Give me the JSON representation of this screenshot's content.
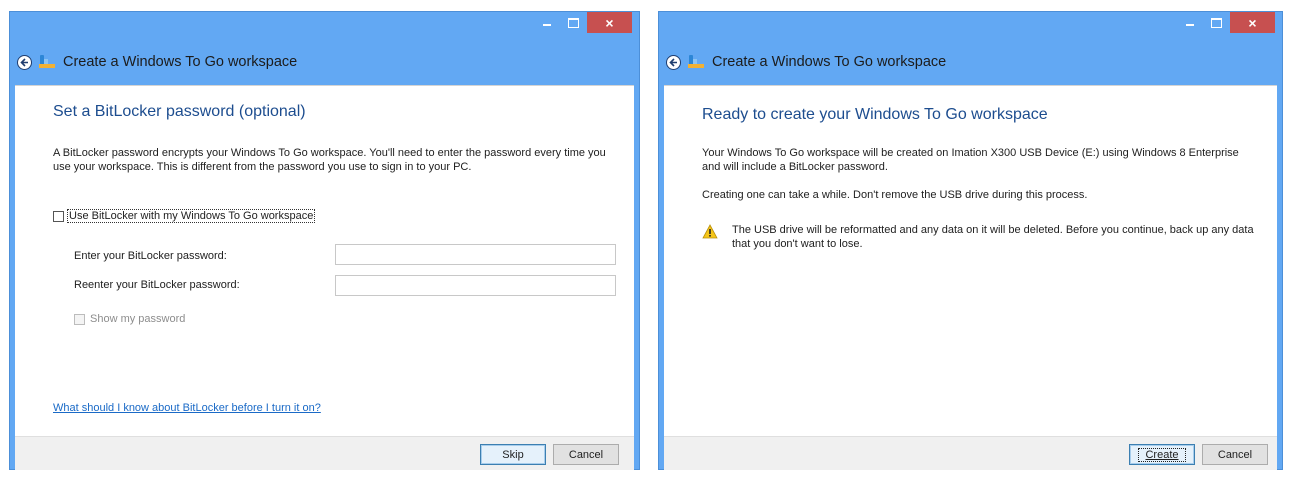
{
  "left_window": {
    "title": "Create a Windows To Go workspace",
    "heading": "Set a BitLocker password (optional)",
    "description": "A BitLocker password encrypts your Windows To Go workspace. You'll need to enter the password every time you use your workspace. This is different from the password you use to sign in to your PC.",
    "use_bitlocker_label": "Use BitLocker with my Windows To Go workspace",
    "use_bitlocker_checked": false,
    "password_label": "Enter your BitLocker password:",
    "password_value": "",
    "reenter_label": "Reenter your BitLocker password:",
    "reenter_value": "",
    "show_password_label": "Show my password",
    "show_password_enabled": false,
    "help_link": "What should I know about BitLocker before I turn it on?",
    "skip_label": "Skip",
    "cancel_label": "Cancel"
  },
  "right_window": {
    "title": "Create a Windows To Go workspace",
    "heading": "Ready to create your Windows To Go workspace",
    "summary": "Your Windows To Go workspace will be created on Imation X300 USB Device (E:) using Windows 8 Enterprise and will include a BitLocker password.",
    "duration_note": "Creating one can take a while. Don't remove the USB drive during this process.",
    "warning": "The USB drive will be reformatted and any data on it will be deleted. Before you continue, back up any data that you don't want to lose.",
    "create_label": "Create",
    "cancel_label": "Cancel"
  },
  "caption_buttons": {
    "close_glyph": "×"
  },
  "colors": {
    "frame": "#62a8f3",
    "heading": "#1d4d8f",
    "link": "#1a6ac7",
    "close_button": "#c75050",
    "warning_icon": "#f5c518"
  }
}
